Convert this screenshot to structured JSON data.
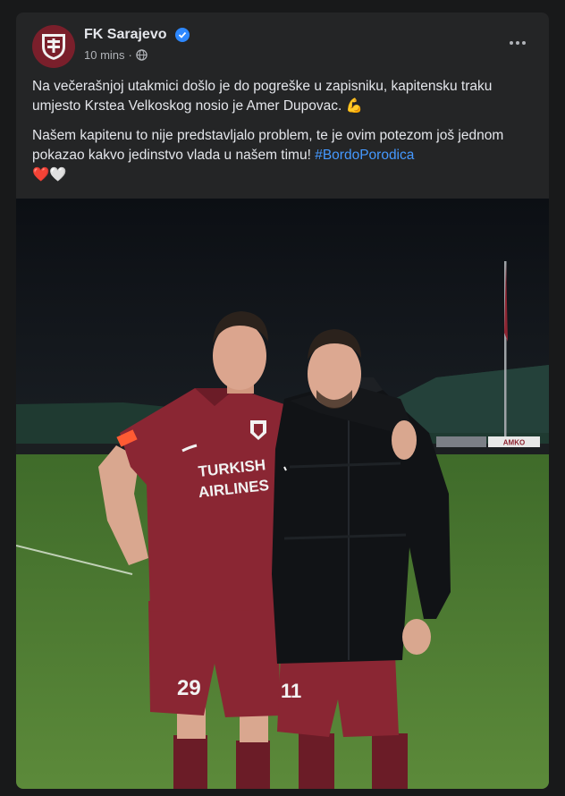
{
  "post": {
    "page_name": "FK Sarajevo",
    "timestamp": "10 mins",
    "visibility_separator": "·",
    "paragraph_1": "Na večerašnjoj utakmici došlo je do pogreške u zapisniku, kapitensku traku umjesto Krstea Velkoskog nosio je Amer Dupovac. 💪",
    "paragraph_2": "Našem kapitenu to nije predstavljalo problem, te je ovim potezom još jednom pokazao kakvo jedinstvo vlada u našem timu!",
    "hashtag": "#BordoPorodica",
    "hearts": "❤️🤍"
  },
  "photo": {
    "sponsor": "TURKISH AIRLINES",
    "shirt_number": "29",
    "shorts_number_2": "11",
    "board_brand": "AMKO"
  },
  "colors": {
    "background": "#18191a",
    "card": "#242526",
    "text": "#e4e6eb",
    "secondary_text": "#b0b3b8",
    "link": "#4599ff",
    "kit_maroon": "#7a1f2b",
    "verified_blue": "#2d88ff"
  },
  "icons": {
    "verified": "verified-badge-icon",
    "globe": "globe-icon",
    "more": "more-options-icon"
  }
}
